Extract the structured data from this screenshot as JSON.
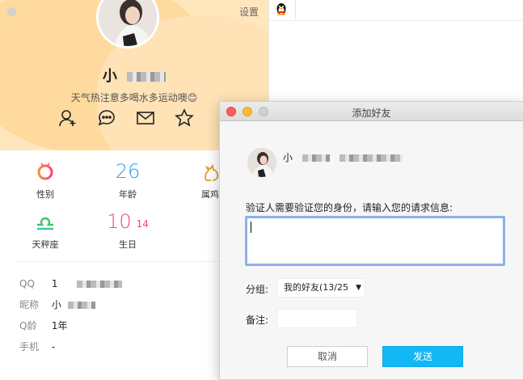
{
  "profile": {
    "settings_label": "设置",
    "nickname": "小",
    "signature": "天气热注意多喝水多运动噢😊",
    "action_icons": [
      "add-friend-icon",
      "message-icon",
      "mail-icon",
      "star-icon"
    ],
    "tags": [
      {
        "label": "性别",
        "icon": "female-gender-icon"
      },
      {
        "label": "年龄",
        "value": "26"
      },
      {
        "label": "属鸡",
        "icon": "rooster-icon"
      },
      {
        "label": "天秤座",
        "icon": "libra-icon"
      },
      {
        "label": "生日",
        "month": "10",
        "day": "14"
      }
    ],
    "info": [
      {
        "key": "QQ",
        "value": "1"
      },
      {
        "key": "昵称",
        "value": "小"
      },
      {
        "key": "Q龄",
        "value": "1年"
      },
      {
        "key": "手机",
        "value": "-"
      }
    ]
  },
  "chat": {
    "tab_icon": "qq-penguin-icon"
  },
  "dialog": {
    "title": "添加好友",
    "name": "小",
    "verify_prompt": "验证人需要验证您的身份，请输入您的请求信息:",
    "verify_value": "",
    "group_label": "分组:",
    "group_value": "我的好友(13/25",
    "remark_label": "备注:",
    "remark_value": "",
    "cancel_label": "取消",
    "send_label": "发送"
  },
  "colors": {
    "banner": "#ffe6bd",
    "send_button": "#12b7f5",
    "age_blue": "#2d9ef0",
    "birthday_pink": "#ee4b6b",
    "libra_green": "#3cc56a"
  }
}
